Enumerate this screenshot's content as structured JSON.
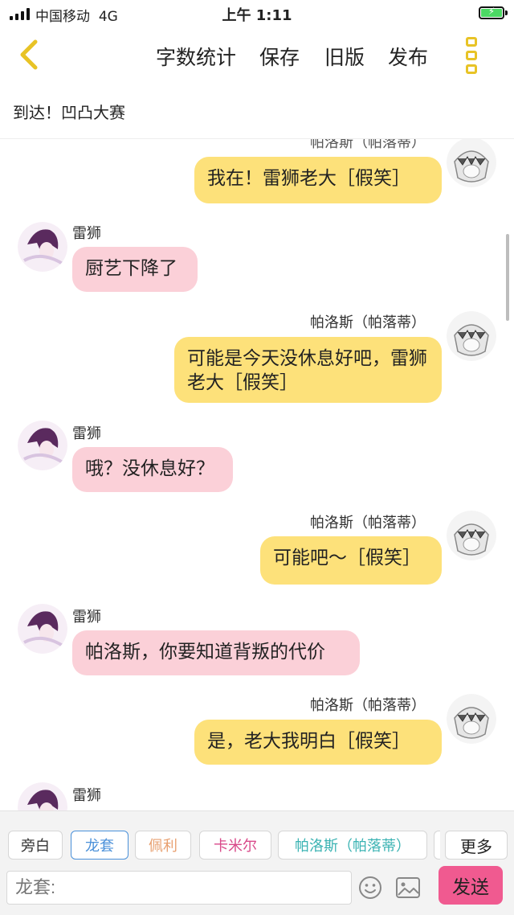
{
  "status_bar": {
    "carrier": "中国移动",
    "network": "4G",
    "time": "上午 1:11"
  },
  "nav": {
    "word_count": "字数统计",
    "save": "保存",
    "old_version": "旧版",
    "publish": "发布"
  },
  "title": "到达！凹凸大赛",
  "messages": [
    {
      "side": "right",
      "name": "帕洛斯（帕落蒂）",
      "text": "我在！雷狮老大［假笑］"
    },
    {
      "side": "left",
      "name": "雷狮",
      "text": "厨艺下降了"
    },
    {
      "side": "right",
      "name": "帕洛斯（帕落蒂）",
      "text": "可能是今天没休息好吧，雷狮老大［假笑］"
    },
    {
      "side": "left",
      "name": "雷狮",
      "text": "哦？没休息好？"
    },
    {
      "side": "right",
      "name": "帕洛斯（帕落蒂）",
      "text": "可能吧～［假笑］"
    },
    {
      "side": "left",
      "name": "雷狮",
      "text": "帕洛斯，你要知道背叛的代价"
    },
    {
      "side": "right",
      "name": "帕洛斯（帕落蒂）",
      "text": "是，老大我明白［假笑］"
    },
    {
      "side": "left",
      "name": "雷狮",
      "text": ""
    }
  ],
  "toolbar": {
    "chips": [
      "旁白",
      "龙套",
      "佩利",
      "卡米尔",
      "帕洛斯（帕落蒂）",
      "更多"
    ],
    "input_placeholder": "龙套:",
    "send_label": "发送"
  },
  "colors": {
    "accent_yellow": "#e8c326",
    "bubble_right": "#fde17a",
    "bubble_left": "#fbd0d8",
    "send_button": "#f05a90",
    "chip_longtao": "#4a90d9",
    "chip_peili": "#e8a070",
    "chip_kamier": "#d94a8a",
    "chip_palos": "#3bb3b3"
  },
  "icons": [
    "back-chevron-icon",
    "more-menu-icon",
    "emoji-icon",
    "image-icon"
  ]
}
